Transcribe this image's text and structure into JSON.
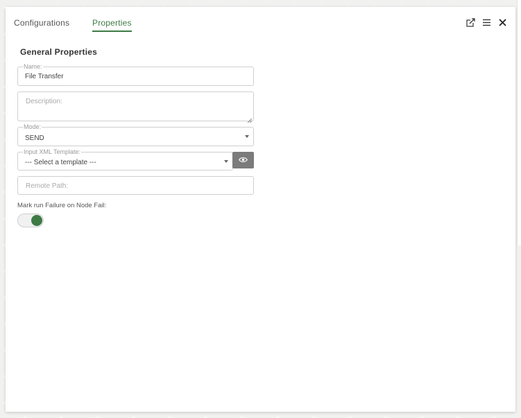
{
  "tabs": [
    {
      "label": "Configurations",
      "active": false
    },
    {
      "label": "Properties",
      "active": true
    }
  ],
  "toolbar": {
    "icons": [
      "expand-icon",
      "menu-icon",
      "close-icon"
    ]
  },
  "section": {
    "title": "General Properties"
  },
  "fields": {
    "name": {
      "legend": "Name:",
      "value": "File Transfer"
    },
    "description": {
      "placeholder": "Description:"
    },
    "mode": {
      "legend": "Mode:",
      "value": "SEND"
    },
    "template": {
      "legend": "Input XML Template:",
      "value": "--- Select a template ---"
    },
    "remote_path": {
      "placeholder": "Remote Path:"
    }
  },
  "toggle": {
    "label": "Mark run Failure on Node Fail:",
    "state": "on"
  },
  "colors": {
    "accent": "#3e7a45",
    "eye_button": "#7b7b7b"
  }
}
